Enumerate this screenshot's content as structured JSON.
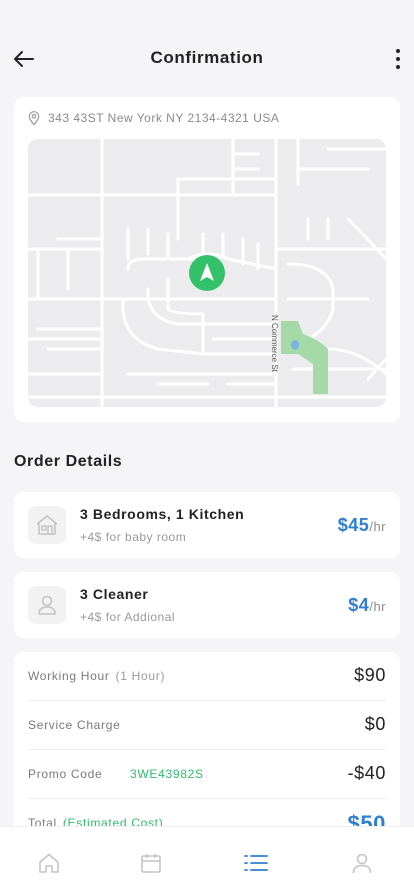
{
  "header": {
    "title": "Confirmation"
  },
  "address": {
    "text": "343 43ST New York NY 2134-4321 USA"
  },
  "map": {
    "street_label": "N Commerce St",
    "accent": "#33c26a"
  },
  "order_details": {
    "title": "Order Details",
    "items": [
      {
        "title": "3 Bedrooms, 1 Kitchen",
        "subtitle": "+4$ for baby room",
        "price": "$45",
        "unit": "/hr",
        "icon": "house-icon"
      },
      {
        "title": "3 Cleaner",
        "subtitle": "+4$ for Addional",
        "price": "$4",
        "unit": "/hr",
        "icon": "person-icon"
      }
    ]
  },
  "summary": {
    "working_hour": {
      "label": "Working Hour",
      "note": "(1 Hour)",
      "value": "$90"
    },
    "service_charge": {
      "label": "Service Charge",
      "value": "$0"
    },
    "promo": {
      "label": "Promo Code",
      "code": "3WE43982S",
      "value": "-$40"
    },
    "total": {
      "label": "Total",
      "note": "(Estimated Cost)",
      "value": "$50"
    }
  },
  "tabbar": {
    "tabs": [
      {
        "icon": "home-icon",
        "active": false
      },
      {
        "icon": "calendar-icon",
        "active": false
      },
      {
        "icon": "list-icon",
        "active": true
      },
      {
        "icon": "profile-icon",
        "active": false
      }
    ],
    "active_color": "#2d7fd1",
    "inactive_color": "#c4c4c4"
  }
}
